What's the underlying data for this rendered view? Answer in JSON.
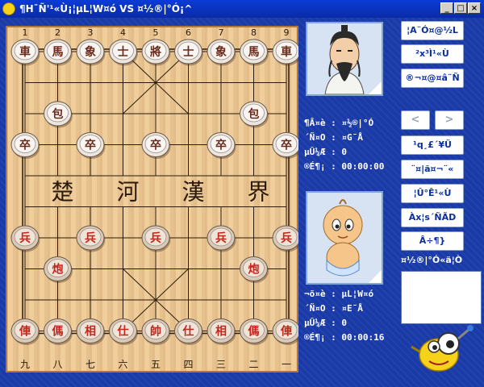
{
  "window": {
    "title": "¶H¯Ñ'¹«Ù¡¦µL¦W¤ó VS ¤½®|°Ó¡^",
    "minimize_glyph": "_",
    "maximize_glyph": "□",
    "close_glyph": "×"
  },
  "board": {
    "top_numbers": [
      "1",
      "2",
      "3",
      "4",
      "5",
      "6",
      "7",
      "8",
      "9"
    ],
    "bottom_numbers": [
      "九",
      "八",
      "七",
      "六",
      "五",
      "四",
      "三",
      "二",
      "一"
    ],
    "river_text": [
      "楚",
      "河",
      "漢",
      "界"
    ],
    "light_pieces": [
      {
        "char": "車",
        "col": 0,
        "row": 0
      },
      {
        "char": "馬",
        "col": 1,
        "row": 0
      },
      {
        "char": "象",
        "col": 2,
        "row": 0
      },
      {
        "char": "士",
        "col": 3,
        "row": 0
      },
      {
        "char": "將",
        "col": 4,
        "row": 0
      },
      {
        "char": "士",
        "col": 5,
        "row": 0
      },
      {
        "char": "象",
        "col": 6,
        "row": 0
      },
      {
        "char": "馬",
        "col": 7,
        "row": 0
      },
      {
        "char": "車",
        "col": 8,
        "row": 0
      },
      {
        "char": "包",
        "col": 1,
        "row": 2
      },
      {
        "char": "包",
        "col": 7,
        "row": 2
      },
      {
        "char": "卒",
        "col": 0,
        "row": 3
      },
      {
        "char": "卒",
        "col": 2,
        "row": 3
      },
      {
        "char": "卒",
        "col": 4,
        "row": 3
      },
      {
        "char": "卒",
        "col": 6,
        "row": 3
      },
      {
        "char": "卒",
        "col": 8,
        "row": 3
      }
    ],
    "red_pieces": [
      {
        "char": "兵",
        "col": 0,
        "row": 6
      },
      {
        "char": "兵",
        "col": 2,
        "row": 6
      },
      {
        "char": "兵",
        "col": 4,
        "row": 6
      },
      {
        "char": "兵",
        "col": 6,
        "row": 6
      },
      {
        "char": "兵",
        "col": 8,
        "row": 6
      },
      {
        "char": "炮",
        "col": 1,
        "row": 7
      },
      {
        "char": "炮",
        "col": 7,
        "row": 7
      },
      {
        "char": "俥",
        "col": 0,
        "row": 9
      },
      {
        "char": "傌",
        "col": 1,
        "row": 9
      },
      {
        "char": "相",
        "col": 2,
        "row": 9
      },
      {
        "char": "仕",
        "col": 3,
        "row": 9
      },
      {
        "char": "帥",
        "col": 4,
        "row": 9
      },
      {
        "char": "仕",
        "col": 5,
        "row": 9
      },
      {
        "char": "相",
        "col": 6,
        "row": 9
      },
      {
        "char": "傌",
        "col": 7,
        "row": 9
      },
      {
        "char": "俥",
        "col": 8,
        "row": 9
      }
    ]
  },
  "opponent": {
    "line1": "¶Â¤è : ¤½®|°Ó",
    "line2": "´Ñ¤O : ¤G¯Å",
    "line3": "µÛ¼Æ : 0",
    "line4": "®É¶¡ : 00:00:00"
  },
  "player": {
    "line1": "¬õ¤è : µL¦W¤ó",
    "line2": "´Ñ¤O : ¤E¯Å",
    "line3": "µÛ¼Æ : 0",
    "line4": "®É¶¡ : 00:00:16"
  },
  "buttons": {
    "b1": "¦A¨Ó¤@½L",
    "b2": "²x³Ì¹«Ù",
    "b3": "®¬¤@¤â¨Ñ",
    "prev": "<",
    "next": ">",
    "b4": "¹q¸£´¥Ü",
    "b5": "¨¤|ã¤¬¨«",
    "b6": "¦Û°Ê¹«Ù",
    "b7": "Àx¦s´ÑÃD",
    "b8": "Â÷¶}"
  },
  "move_list": {
    "label": "¤½®|°Ó«ä¦Ò"
  },
  "colors": {
    "background_blue": "#1a3aa8",
    "board_wood": "#eecb98",
    "red_piece_text": "#c0261c",
    "light_piece_text": "#c0261c"
  }
}
